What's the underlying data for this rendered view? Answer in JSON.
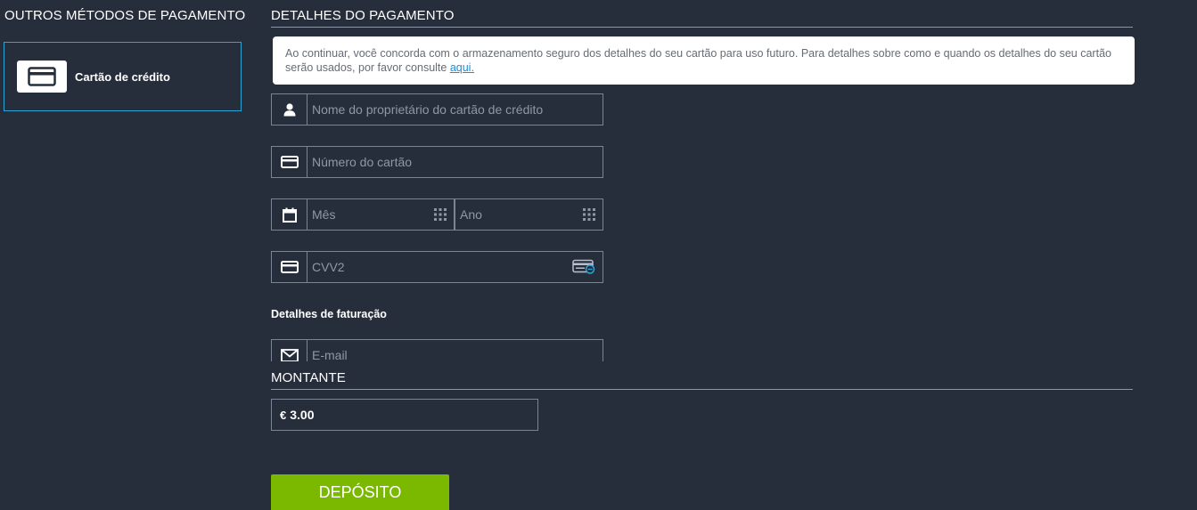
{
  "sidebar": {
    "title": "OUTROS MÉTODOS DE PAGAMENTO",
    "methods": [
      {
        "label": "Cartão de crédito",
        "icon": "credit-card-icon",
        "selected": true
      }
    ]
  },
  "details": {
    "title": "DETALHES DO PAGAMENTO",
    "notice_text": "Ao continuar, você concorda com o armazenamento seguro dos detalhes do seu cartão para uso futuro. Para detalhes sobre como e quando os detalhes do seu cartão serão usados, por favor consulte ",
    "notice_link": "aqui.",
    "fields": {
      "holder_placeholder": "Nome do proprietário do cartão de crédito",
      "number_placeholder": "Número do cartão",
      "month_placeholder": "Mês",
      "year_placeholder": "Ano",
      "cvv_placeholder": "CVV2"
    },
    "billing_title": "Detalhes de faturação",
    "email_placeholder": "E-mail"
  },
  "amount": {
    "title": "MONTANTE",
    "currency": "€",
    "value": "3.00"
  },
  "deposit_label": "DEPÓSITO",
  "colors": {
    "background": "#262e3b",
    "accent": "#2ea3d6",
    "button": "#7bb800",
    "link": "#1a8fd6"
  }
}
